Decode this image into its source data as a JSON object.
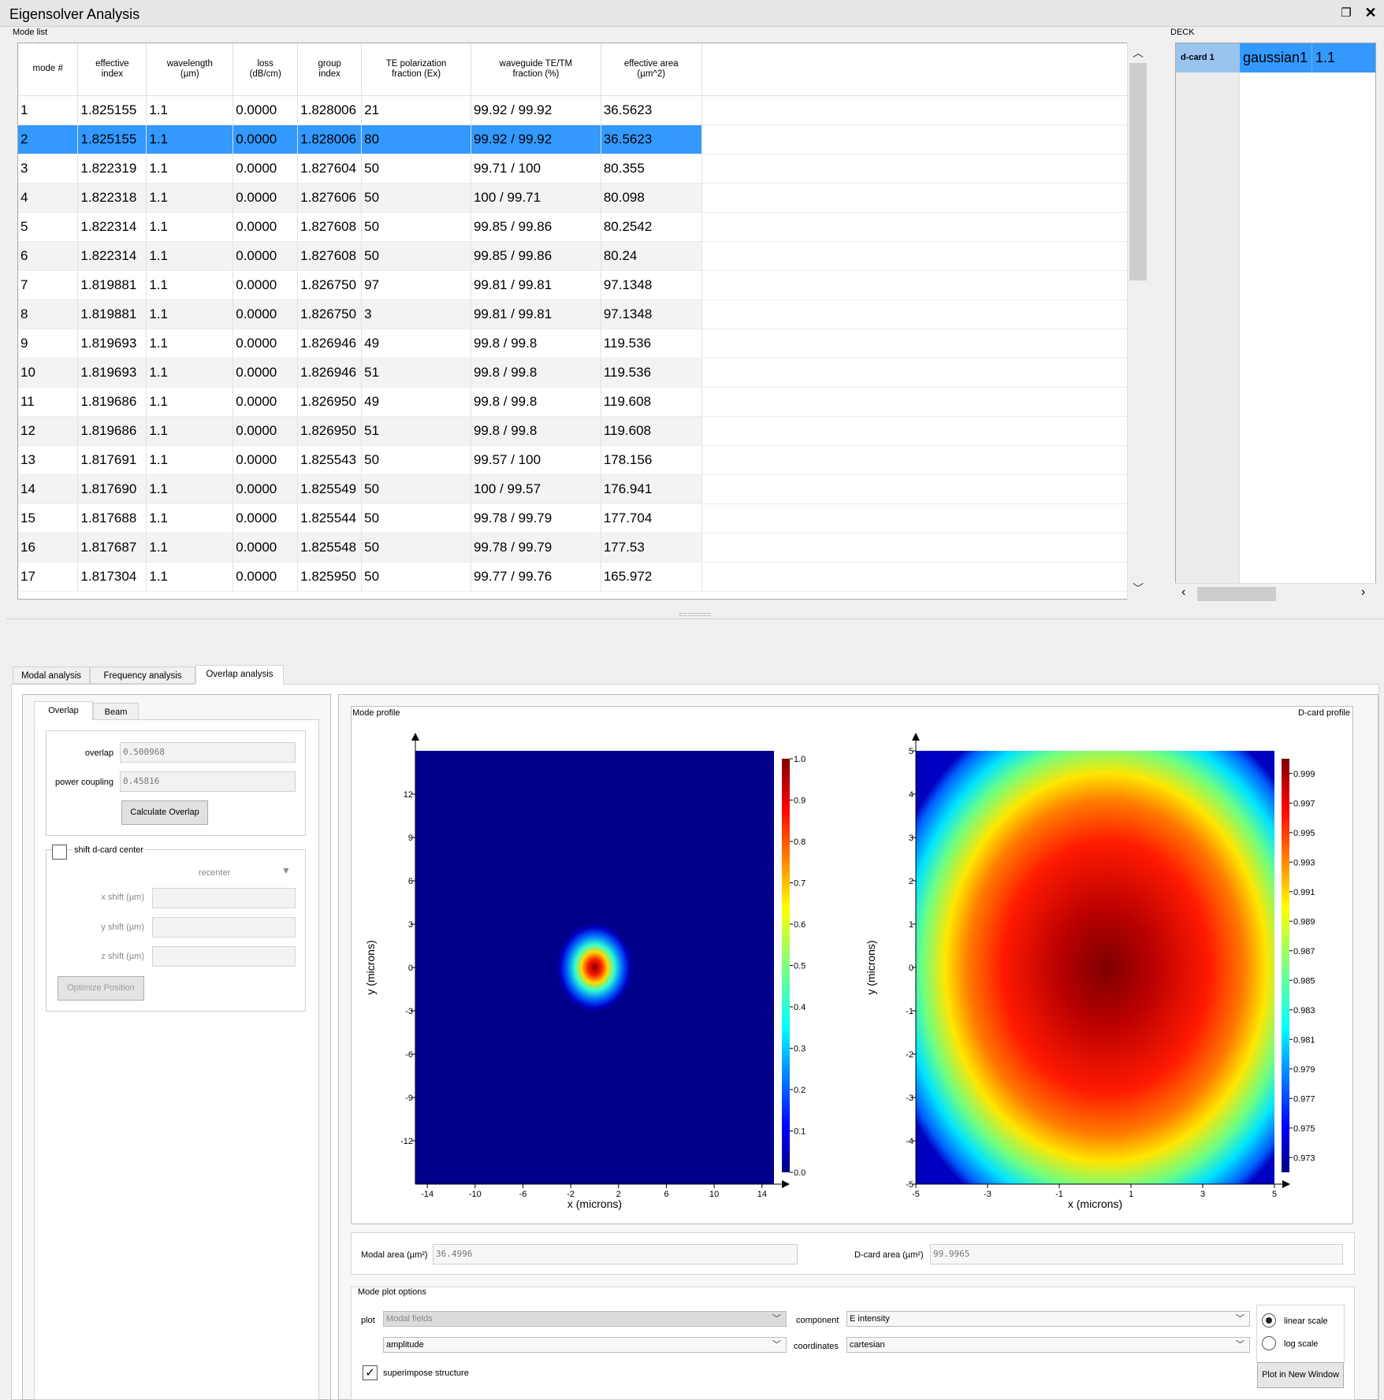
{
  "window": {
    "title": "Eigensolver Analysis"
  },
  "mode_list": {
    "label": "Mode list",
    "columns": [
      "mode #",
      "effective\nindex",
      "wavelength\n(µm)",
      "loss\n(dB/cm)",
      "group\nindex",
      "TE polarization\nfraction (Ex)",
      "waveguide TE/TM\nfraction (%)",
      "effective area\n(µm^2)"
    ],
    "selected_row": 1,
    "rows": [
      [
        "1",
        "1.825155",
        "1.1",
        "0.0000",
        "1.828006",
        "21",
        "99.92 / 99.92",
        "36.5623"
      ],
      [
        "2",
        "1.825155",
        "1.1",
        "0.0000",
        "1.828006",
        "80",
        "99.92 / 99.92",
        "36.5623"
      ],
      [
        "3",
        "1.822319",
        "1.1",
        "0.0000",
        "1.827604",
        "50",
        "99.71 / 100",
        "80.355"
      ],
      [
        "4",
        "1.822318",
        "1.1",
        "0.0000",
        "1.827606",
        "50",
        "100 / 99.71",
        "80.098"
      ],
      [
        "5",
        "1.822314",
        "1.1",
        "0.0000",
        "1.827608",
        "50",
        "99.85 / 99.86",
        "80.2542"
      ],
      [
        "6",
        "1.822314",
        "1.1",
        "0.0000",
        "1.827608",
        "50",
        "99.85 / 99.86",
        "80.24"
      ],
      [
        "7",
        "1.819881",
        "1.1",
        "0.0000",
        "1.826750",
        "97",
        "99.81 / 99.81",
        "97.1348"
      ],
      [
        "8",
        "1.819881",
        "1.1",
        "0.0000",
        "1.826750",
        "3",
        "99.81 / 99.81",
        "97.1348"
      ],
      [
        "9",
        "1.819693",
        "1.1",
        "0.0000",
        "1.826946",
        "49",
        "99.8 / 99.8",
        "119.536"
      ],
      [
        "10",
        "1.819693",
        "1.1",
        "0.0000",
        "1.826946",
        "51",
        "99.8 / 99.8",
        "119.536"
      ],
      [
        "11",
        "1.819686",
        "1.1",
        "0.0000",
        "1.826950",
        "49",
        "99.8 / 99.8",
        "119.608"
      ],
      [
        "12",
        "1.819686",
        "1.1",
        "0.0000",
        "1.826950",
        "51",
        "99.8 / 99.8",
        "119.608"
      ],
      [
        "13",
        "1.817691",
        "1.1",
        "0.0000",
        "1.825543",
        "50",
        "99.57 / 100",
        "178.156"
      ],
      [
        "14",
        "1.817690",
        "1.1",
        "0.0000",
        "1.825549",
        "50",
        "100 / 99.57",
        "176.941"
      ],
      [
        "15",
        "1.817688",
        "1.1",
        "0.0000",
        "1.825544",
        "50",
        "99.78 / 99.79",
        "177.704"
      ],
      [
        "16",
        "1.817687",
        "1.1",
        "0.0000",
        "1.825548",
        "50",
        "99.78 / 99.79",
        "177.53"
      ],
      [
        "17",
        "1.817304",
        "1.1",
        "0.0000",
        "1.825950",
        "50",
        "99.77 / 99.76",
        "165.972"
      ]
    ]
  },
  "deck": {
    "label": "DECK",
    "card": "d-card 1",
    "name": "gaussian1",
    "value": "1.1"
  },
  "tabs": [
    "Modal analysis",
    "Frequency analysis",
    "Overlap analysis"
  ],
  "active_tab": "Overlap analysis",
  "overlap_panel": {
    "subtabs": [
      "Overlap",
      "Beam"
    ],
    "overlap_label": "overlap",
    "overlap_value": "0.500968",
    "power_coupling_label": "power coupling",
    "power_coupling_value": "0.45816",
    "calculate_button": "Calculate Overlap",
    "shift_label": "shift d-card center",
    "recenter": "recenter",
    "x_shift_label": "x shift (µm)",
    "y_shift_label": "y shift (µm)",
    "z_shift_label": "z shift (µm)",
    "optimize_button": "Optimize Position"
  },
  "plots": {
    "mode_profile_label": "Mode profile",
    "dcard_profile_label": "D-card profile",
    "xlabel": "x (microns)",
    "ylabel": "y (microns)"
  },
  "chart_data": [
    {
      "type": "heatmap",
      "title": "Mode profile",
      "xlabel": "x (microns)",
      "ylabel": "y (microns)",
      "xlim": [
        -15,
        15
      ],
      "ylim": [
        -15,
        15
      ],
      "xticks": [
        -14,
        -10,
        -6,
        -2,
        2,
        6,
        10,
        14
      ],
      "yticks": [
        -12,
        -9,
        -6,
        -3,
        0,
        3,
        6,
        9,
        12
      ],
      "colorbar": {
        "min": 0.0,
        "max": 1.0,
        "ticks": [
          "0.0",
          "0.1",
          "0.2",
          "0.3",
          "0.4",
          "0.5",
          "0.6",
          "0.7",
          "0.8",
          "0.9",
          "1.0"
        ]
      },
      "colormap": "jet",
      "peak": {
        "x": 0,
        "y": 0,
        "value": 1.0
      }
    },
    {
      "type": "heatmap",
      "title": "D-card profile",
      "xlabel": "x (microns)",
      "ylabel": "y (microns)",
      "xlim": [
        -5,
        5
      ],
      "ylim": [
        -5,
        5
      ],
      "xticks": [
        -5,
        -3,
        -1,
        1,
        3,
        5
      ],
      "yticks": [
        -5,
        -4,
        -3,
        -2,
        -1,
        0,
        1,
        2,
        3,
        4,
        5
      ],
      "colorbar": {
        "min": 0.972,
        "max": 1.0,
        "ticks": [
          "0.973",
          "0.975",
          "0.977",
          "0.979",
          "0.981",
          "0.983",
          "0.985",
          "0.987",
          "0.989",
          "0.991",
          "0.993",
          "0.995",
          "0.997",
          "0.999"
        ]
      },
      "colormap": "jet",
      "peak": {
        "x": 0,
        "y": 0,
        "value": 1.0
      }
    }
  ],
  "areas": {
    "modal_label": "Modal area (µm²)",
    "modal_value": "36.4996",
    "dcard_label": "D-card area (µm²)",
    "dcard_value": "99.9965"
  },
  "plot_options": {
    "title": "Mode plot options",
    "plot_label": "plot",
    "plot_value": "Modal fields",
    "amplitude_value": "amplitude",
    "component_label": "component",
    "component_value": "E intensity",
    "coordinates_label": "coordinates",
    "coordinates_value": "cartesian",
    "linear_scale": "linear scale",
    "log_scale": "log scale",
    "scale_selected": "linear",
    "superimpose_label": "superimpose structure",
    "superimpose_checked": true,
    "plot_new_window_button": "Plot in New Window"
  }
}
